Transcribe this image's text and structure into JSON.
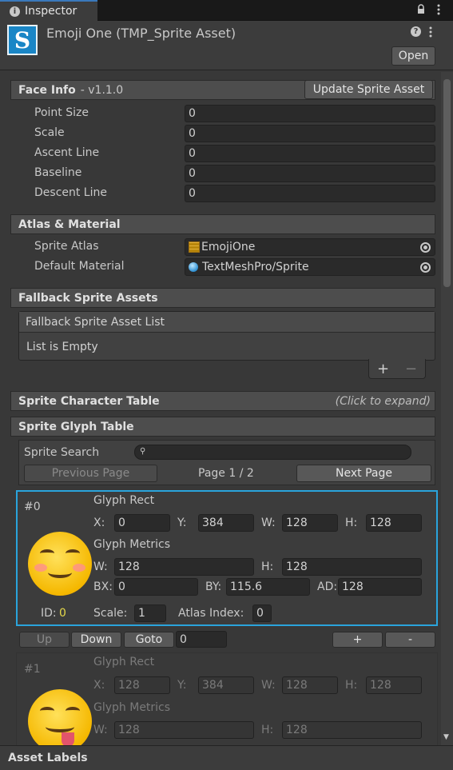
{
  "tab": {
    "label": "Inspector"
  },
  "header": {
    "title": "Emoji One (TMP_Sprite Asset)",
    "open_label": "Open",
    "asset_icon_letter": "S"
  },
  "face_info": {
    "title": "Face Info",
    "version": "- v1.1.0",
    "update_label": "Update Sprite Asset",
    "fields": [
      {
        "label": "Point Size",
        "value": "0"
      },
      {
        "label": "Scale",
        "value": "0"
      },
      {
        "label": "Ascent Line",
        "value": "0"
      },
      {
        "label": "Baseline",
        "value": "0"
      },
      {
        "label": "Descent Line",
        "value": "0"
      }
    ]
  },
  "atlas": {
    "title": "Atlas & Material",
    "sprite_atlas_label": "Sprite Atlas",
    "sprite_atlas_value": "EmojiOne",
    "default_material_label": "Default Material",
    "default_material_value": "TextMeshPro/Sprite"
  },
  "fallback": {
    "title": "Fallback Sprite Assets",
    "list_title": "Fallback Sprite Asset List",
    "empty_text": "List is Empty",
    "plus": "+",
    "minus": "−"
  },
  "char_table": {
    "title": "Sprite Character Table",
    "hint": "(Click to expand)"
  },
  "glyph_table": {
    "title": "Sprite Glyph Table",
    "search_label": "Sprite Search",
    "search_value": "",
    "prev_label": "Previous Page",
    "page_label": "Page 1 / 2",
    "next_label": "Next Page"
  },
  "glyphs": [
    {
      "index": "#0",
      "rect_label": "Glyph Rect",
      "x_label": "X:",
      "x": "0",
      "y_label": "Y:",
      "y": "384",
      "w_label": "W:",
      "w": "128",
      "h_label": "H:",
      "h": "128",
      "metrics_label": "Glyph Metrics",
      "mw_label": "W:",
      "mw": "128",
      "mh_label": "H:",
      "mh": "128",
      "bx_label": "BX:",
      "bx": "0",
      "by_label": "BY:",
      "by": "115.6",
      "ad_label": "AD:",
      "ad": "128",
      "id_label": "ID:",
      "id": "0",
      "scale_label": "Scale:",
      "scale": "1",
      "atlas_index_label": "Atlas Index:",
      "atlas_index": "0"
    },
    {
      "index": "#1",
      "rect_label": "Glyph Rect",
      "x_label": "X:",
      "x": "128",
      "y_label": "Y:",
      "y": "384",
      "w_label": "W:",
      "w": "128",
      "h_label": "H:",
      "h": "128",
      "metrics_label": "Glyph Metrics",
      "mw_label": "W:",
      "mw": "128",
      "mh_label": "H:",
      "mh": "128"
    }
  ],
  "row_toolbar": {
    "up": "Up",
    "down": "Down",
    "goto": "Goto",
    "goto_value": "0",
    "add": "+",
    "remove": "-"
  },
  "footer": {
    "label": "Asset Labels"
  },
  "colors": {
    "selection": "#2aa4dc",
    "id_value": "#e6d94a",
    "accent": "#3a79bb"
  }
}
